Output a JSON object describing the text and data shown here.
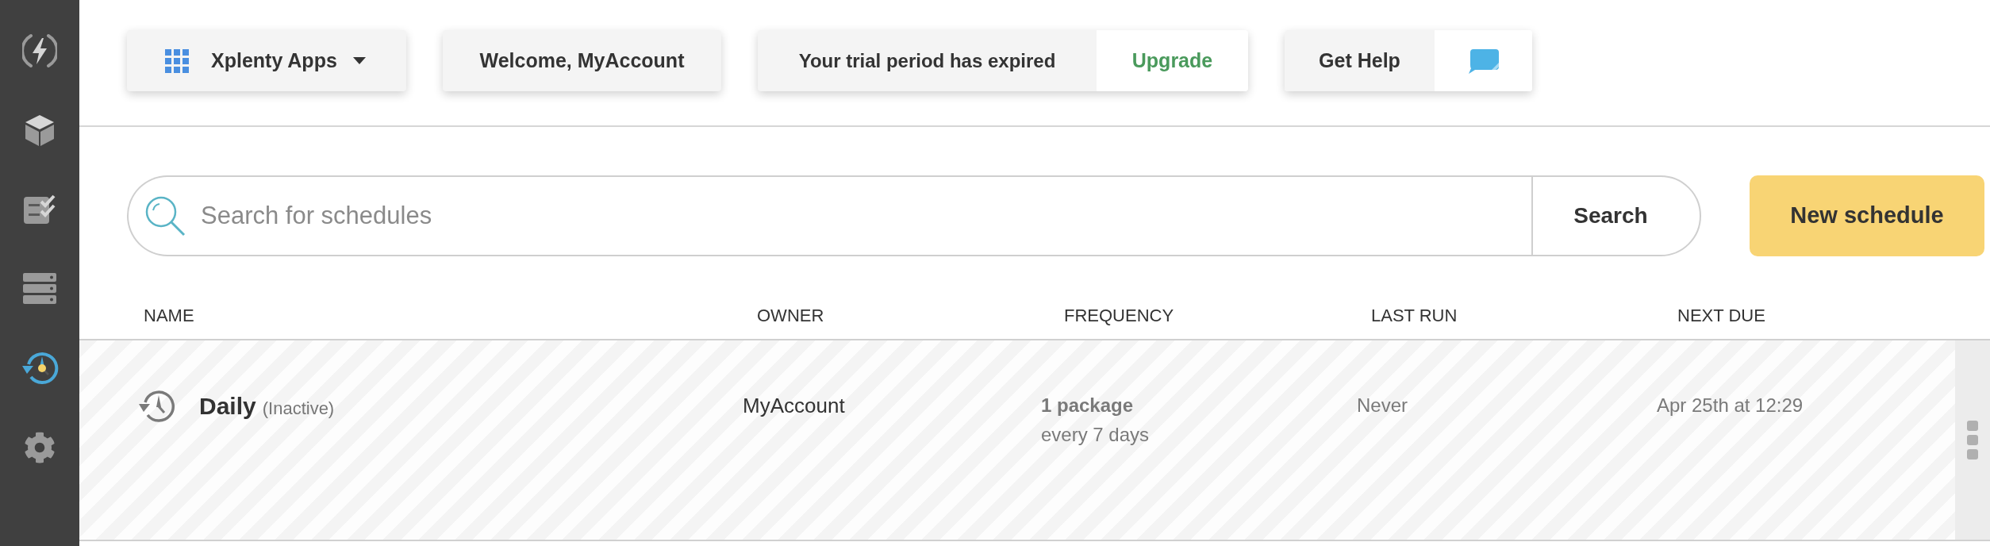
{
  "sidebar": {
    "items": [
      {
        "kind": "bolt",
        "selected": false
      },
      {
        "kind": "cube",
        "selected": false
      },
      {
        "kind": "checklist",
        "selected": false
      },
      {
        "kind": "server",
        "selected": false
      },
      {
        "kind": "clock",
        "selected": true
      },
      {
        "kind": "gear",
        "selected": false
      }
    ]
  },
  "top_bar": {
    "apps_menu": {
      "label": "Xplenty Apps"
    },
    "welcome": "Welcome, MyAccount",
    "trial": {
      "message": "Your trial period has expired",
      "action": "Upgrade"
    },
    "help": {
      "label": "Get Help"
    }
  },
  "search": {
    "placeholder": "Search for schedules",
    "button": "Search"
  },
  "new_button": "New schedule",
  "table": {
    "columns": [
      "NAME",
      "OWNER",
      "FREQUENCY",
      "LAST RUN",
      "NEXT DUE"
    ],
    "rows": [
      {
        "name": "Daily",
        "status": "(Inactive)",
        "owner": "MyAccount",
        "frequency": {
          "packages": "1 package",
          "interval": "every 7 days"
        },
        "last_run": "Never",
        "next_due": "Apr 25th at 12:29"
      }
    ]
  }
}
